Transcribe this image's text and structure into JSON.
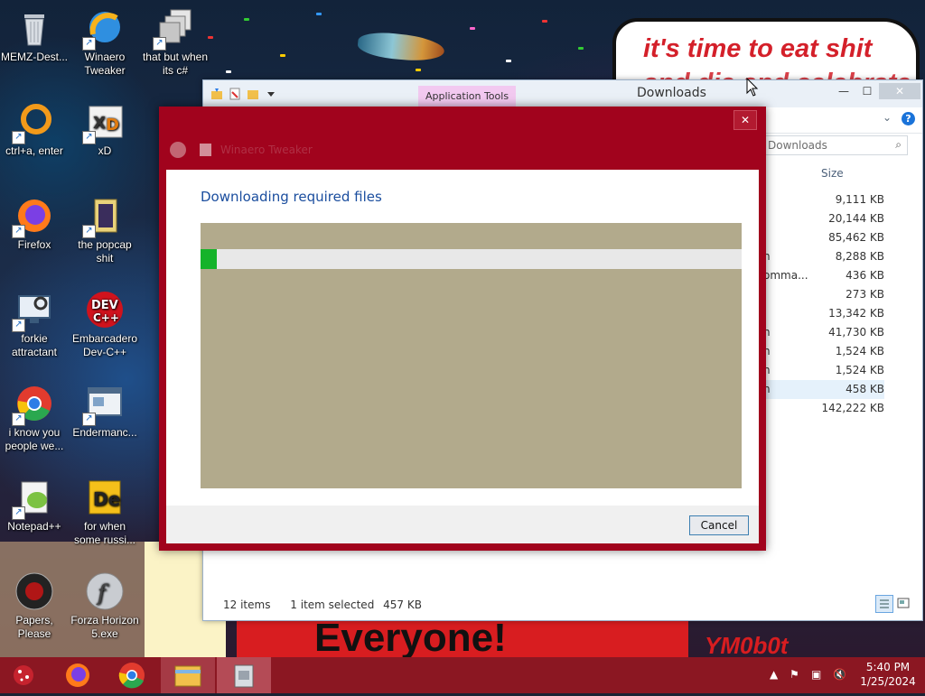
{
  "desktop": {
    "meme_top_text": "it's time to eat shit",
    "meme_top_text_line2": "and die and celebrate",
    "meme_bottom_text": "Everyone!",
    "meme_bottom_right_text": "YM0b0t",
    "icons": [
      {
        "label": "MEMZ-Dest..."
      },
      {
        "label": "Winaero Tweaker"
      },
      {
        "label": "that but when its c#"
      },
      {
        "label": "ctrl+a, enter"
      },
      {
        "label": "xD"
      },
      {
        "label": "Firefox"
      },
      {
        "label": "the popcap shit"
      },
      {
        "label": "forkie attractant"
      },
      {
        "label": "Embarcadero Dev-C++"
      },
      {
        "label": "i know you people we..."
      },
      {
        "label": "Endermanc..."
      },
      {
        "label": "Notepad++"
      },
      {
        "label": "for when some russi..."
      },
      {
        "label": "Papers, Please"
      },
      {
        "label": "Forza Horizon 5.exe"
      }
    ]
  },
  "explorer": {
    "contextual_tab": "Application Tools",
    "title": "Downloads",
    "search_placeholder": "Downloads",
    "size_header": "Size",
    "rows": [
      {
        "name": "",
        "size": "9,111 KB"
      },
      {
        "name": "",
        "size": "20,144 KB"
      },
      {
        "name": "",
        "size": "85,462 KB"
      },
      {
        "name": "n",
        "size": "8,288 KB"
      },
      {
        "name": "omma...",
        "size": "436 KB"
      },
      {
        "name": "",
        "size": "273 KB"
      },
      {
        "name": "",
        "size": "13,342 KB"
      },
      {
        "name": "n",
        "size": "41,730 KB"
      },
      {
        "name": "n",
        "size": "1,524 KB"
      },
      {
        "name": "n",
        "size": "1,524 KB"
      },
      {
        "name": "n",
        "size": "458 KB"
      },
      {
        "name": "",
        "size": "142,222 KB"
      }
    ],
    "status_items": "12 items",
    "status_selected": "1 item selected",
    "status_size": "457 KB"
  },
  "dialog": {
    "window_title": "Winaero Tweaker",
    "heading": "Downloading required files",
    "progress": 0.03,
    "cancel_label": "Cancel",
    "close_glyph": "✕"
  },
  "taskbar": {
    "time": "5:40 PM",
    "date": "1/25/2024"
  },
  "colors": {
    "dialog_frame": "#a1031d",
    "progress_fill": "#15b32a",
    "taskbar": "#8b1722",
    "heading": "#1a4d9e"
  }
}
